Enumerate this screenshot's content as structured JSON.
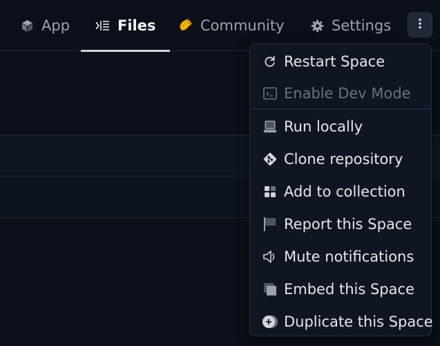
{
  "tabs": [
    {
      "label": "App",
      "icon": "cube-icon",
      "active": false
    },
    {
      "label": "Files",
      "icon": "files-icon",
      "active": true
    },
    {
      "label": "Community",
      "icon": "clapping-hands-icon",
      "active": false
    },
    {
      "label": "Settings",
      "icon": "gear-icon",
      "active": false
    }
  ],
  "more_button": {
    "icon": "vertical-ellipsis-icon"
  },
  "menu": {
    "items": [
      {
        "label": "Restart Space",
        "icon": "restart-icon",
        "disabled": false
      },
      {
        "label": "Enable Dev Mode",
        "icon": "terminal-icon",
        "disabled": true
      },
      {
        "label": "Run locally",
        "icon": "laptop-icon",
        "disabled": false
      },
      {
        "label": "Clone repository",
        "icon": "git-icon",
        "disabled": false
      },
      {
        "label": "Add to collection",
        "icon": "collection-icon",
        "disabled": false
      },
      {
        "label": "Report this Space",
        "icon": "flag-icon",
        "disabled": false
      },
      {
        "label": "Mute notifications",
        "icon": "speaker-icon",
        "disabled": false
      },
      {
        "label": "Embed this Space",
        "icon": "embed-icon",
        "disabled": false
      },
      {
        "label": "Duplicate this Space",
        "icon": "duplicate-icon",
        "disabled": false
      }
    ]
  },
  "colors": {
    "background": "#0b0f19",
    "menu_background": "#0f1523",
    "text_primary": "#e5e7eb",
    "text_muted": "#9ca3af",
    "text_disabled": "#6b7280",
    "community_accent": "#f5b800"
  }
}
